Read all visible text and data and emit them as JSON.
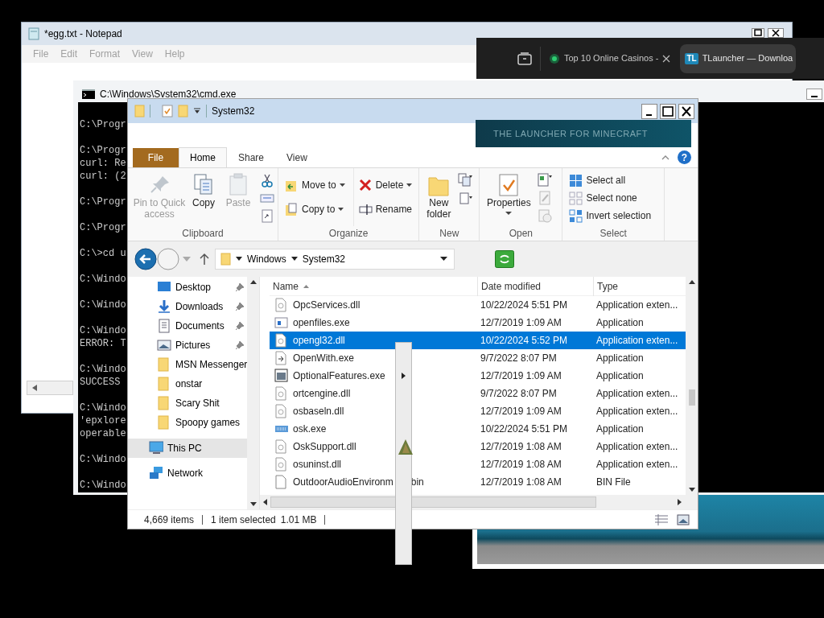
{
  "notepad": {
    "title": "*egg.txt - Notepad",
    "menu": [
      "File",
      "Edit",
      "Format",
      "View",
      "Help"
    ]
  },
  "browser": {
    "tabs": [
      {
        "label": "Top 10 Online Casinos -",
        "selected": false
      },
      {
        "label": "TLauncher — Downloa",
        "selected": true,
        "icon_text": "TL"
      }
    ]
  },
  "cmd": {
    "title": "C:\\Windows\\Svstem32\\cmd.exe",
    "blocks": [
      [
        "C:\\Progr"
      ],
      [
        "C:\\Progr",
        "curl: Re",
        "curl: (2"
      ],
      [
        "C:\\Progr"
      ],
      [
        "C:\\Progr"
      ],
      [
        "C:\\>cd u"
      ],
      [
        "C:\\Windo"
      ],
      [
        "C:\\Windo"
      ],
      [
        "C:\\Windo",
        "ERROR: T"
      ],
      [
        "C:\\Windo",
        "SUCCESS"
      ],
      [
        "C:\\Windo",
        "'epxlore",
        "operable"
      ],
      [
        "C:\\Windo"
      ],
      [
        "C:\\Windo"
      ]
    ]
  },
  "explorer": {
    "title": "System32",
    "banner": "THE LAUNCHER FOR MINECRAFT",
    "help": "?",
    "ribbon_tabs": [
      {
        "label": "File",
        "kind": "file"
      },
      {
        "label": "Home",
        "kind": "tab",
        "selected": true
      },
      {
        "label": "Share",
        "kind": "tab",
        "selected": false
      },
      {
        "label": "View",
        "kind": "tab",
        "selected": false
      }
    ],
    "ribbon_groups": [
      {
        "label": "Clipboard",
        "kind": "clipboard",
        "items": [
          {
            "label": "Pin to Quick access",
            "kind": "pin",
            "disabled": true
          },
          {
            "label": "Copy",
            "kind": "copy",
            "disabled": false
          },
          {
            "label": "Paste",
            "kind": "paste",
            "disabled": true
          }
        ]
      },
      {
        "label": "Organize",
        "kind": "organize",
        "items": [
          {
            "label": "Move to",
            "kind": "move",
            "has_menu": true
          },
          {
            "label": "Copy to",
            "kind": "copyto",
            "has_menu": true
          },
          {
            "label": "Delete",
            "kind": "delete",
            "has_menu": true
          },
          {
            "label": "Rename",
            "kind": "rename",
            "has_menu": false
          }
        ]
      },
      {
        "label": "New",
        "kind": "new",
        "items": [
          {
            "label": "New folder",
            "kind": "newfolder"
          }
        ]
      },
      {
        "label": "Open",
        "kind": "open",
        "items": [
          {
            "label": "Properties",
            "kind": "properties",
            "has_menu": true
          }
        ]
      },
      {
        "label": "Select",
        "kind": "select",
        "items": [
          {
            "label": "Select all",
            "kind": "selectall"
          },
          {
            "label": "Select none",
            "kind": "selectnone"
          },
          {
            "label": "Invert selection",
            "kind": "invert"
          }
        ]
      }
    ],
    "address": {
      "path": [
        "Windows",
        "System32"
      ]
    },
    "nav": [
      {
        "label": "Desktop",
        "kind": "desktop",
        "pinned": true,
        "selected": false
      },
      {
        "label": "Downloads",
        "kind": "downloads",
        "pinned": true,
        "selected": false
      },
      {
        "label": "Documents",
        "kind": "documents",
        "pinned": true,
        "selected": false
      },
      {
        "label": "Pictures",
        "kind": "pictures",
        "pinned": true,
        "selected": false
      },
      {
        "label": "MSN Messenger",
        "kind": "folder",
        "pinned": false,
        "selected": false
      },
      {
        "label": "onstar",
        "kind": "folder",
        "pinned": false,
        "selected": false
      },
      {
        "label": "Scary Shit",
        "kind": "folder",
        "pinned": false,
        "selected": false
      },
      {
        "label": "Spoopy games",
        "kind": "folder",
        "pinned": false,
        "selected": false
      },
      {
        "label": "This PC",
        "kind": "pc",
        "pinned": false,
        "selected": true
      },
      {
        "label": "Network",
        "kind": "network",
        "pinned": false,
        "selected": false
      }
    ],
    "columns": [
      {
        "label": "Name",
        "sorted": true
      },
      {
        "label": "Date modified",
        "sorted": false
      },
      {
        "label": "Type",
        "sorted": false
      }
    ],
    "rows": [
      {
        "name": "OpcServices.dll",
        "date": "10/22/2024 5:51 PM",
        "type": "Application exten...",
        "kind": "dll",
        "selected": false
      },
      {
        "name": "openfiles.exe",
        "date": "12/7/2019 1:09 AM",
        "type": "Application",
        "kind": "window",
        "selected": false
      },
      {
        "name": "opengl32.dll",
        "date": "10/22/2024 5:52 PM",
        "type": "Application exten...",
        "kind": "dll",
        "selected": true
      },
      {
        "name": "OpenWith.exe",
        "date": "9/7/2022 8:07 PM",
        "type": "Application",
        "kind": "openwith",
        "selected": false
      },
      {
        "name": "OptionalFeatures.exe",
        "date": "12/7/2019 1:09 AM",
        "type": "Application",
        "kind": "features",
        "selected": false
      },
      {
        "name": "ortcengine.dll",
        "date": "9/7/2022 8:07 PM",
        "type": "Application exten...",
        "kind": "dll",
        "selected": false
      },
      {
        "name": "osbaseln.dll",
        "date": "12/7/2019 1:09 AM",
        "type": "Application exten...",
        "kind": "dll",
        "selected": false
      },
      {
        "name": "osk.exe",
        "date": "10/22/2024 5:51 PM",
        "type": "Application",
        "kind": "keyboard",
        "selected": false
      },
      {
        "name": "OskSupport.dll",
        "date": "12/7/2019 1:08 AM",
        "type": "Application exten...",
        "kind": "dll",
        "selected": false
      },
      {
        "name": "osuninst.dll",
        "date": "12/7/2019 1:08 AM",
        "type": "Application exten...",
        "kind": "dll",
        "selected": false
      },
      {
        "name": "OutdoorAudioEnvironm",
        "name_tail": "bin",
        "date": "12/7/2019 1:08 AM",
        "type": "BIN File",
        "kind": "file",
        "selected": false
      }
    ],
    "status": {
      "count": "4,669 items",
      "selection": "1 item selected",
      "size": "1.01 MB"
    }
  }
}
